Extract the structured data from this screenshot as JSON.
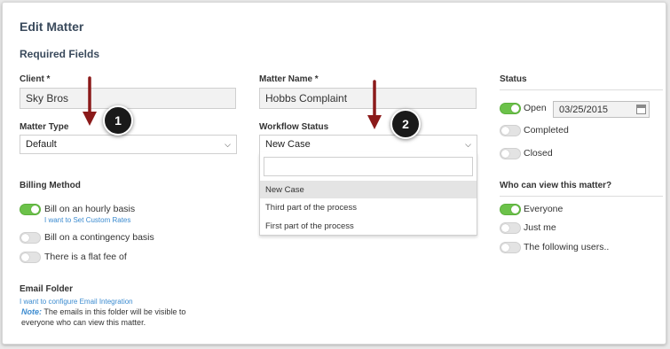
{
  "page": {
    "title": "Edit Matter",
    "section_title": "Required Fields"
  },
  "client": {
    "label": "Client *",
    "value": "Sky Bros"
  },
  "matter_name": {
    "label": "Matter Name *",
    "value": "Hobbs Complaint"
  },
  "matter_type": {
    "label": "Matter Type",
    "selected": "Default"
  },
  "workflow_status": {
    "label": "Workflow Status",
    "selected": "New Case",
    "options": [
      "New Case",
      "Third part of the process",
      "First part of the process"
    ]
  },
  "billing": {
    "label": "Billing Method",
    "options": [
      {
        "label": "Bill on an hourly basis",
        "on": true
      },
      {
        "label": "Bill on a contingency basis",
        "on": false
      },
      {
        "label": "There is a flat fee of",
        "on": false
      }
    ],
    "custom_rates_link": "I want to Set Custom Rates"
  },
  "email_folder": {
    "label": "Email Folder",
    "link": "I want to configure Email Integration",
    "note_label": "Note:",
    "note_text_1": "The emails in this folder will be visible to",
    "note_text_2": "everyone who can view this matter."
  },
  "status": {
    "label": "Status",
    "options": [
      {
        "label": "Open",
        "on": true
      },
      {
        "label": "Completed",
        "on": false
      },
      {
        "label": "Closed",
        "on": false
      }
    ],
    "date": "03/25/2015"
  },
  "visibility": {
    "label": "Who can view this matter?",
    "options": [
      {
        "label": "Everyone",
        "on": true
      },
      {
        "label": "Just me",
        "on": false
      },
      {
        "label": "The following users..",
        "on": false
      }
    ]
  },
  "callouts": {
    "one": "1",
    "two": "2"
  },
  "colors": {
    "toggle_on": "#6cc24a",
    "arrow": "#8b1a1a",
    "link": "#3b8bd0",
    "heading": "#3a4a5c"
  },
  "icons": [
    "chevron-down-icon",
    "calendar-icon",
    "arrow-down-icon"
  ]
}
